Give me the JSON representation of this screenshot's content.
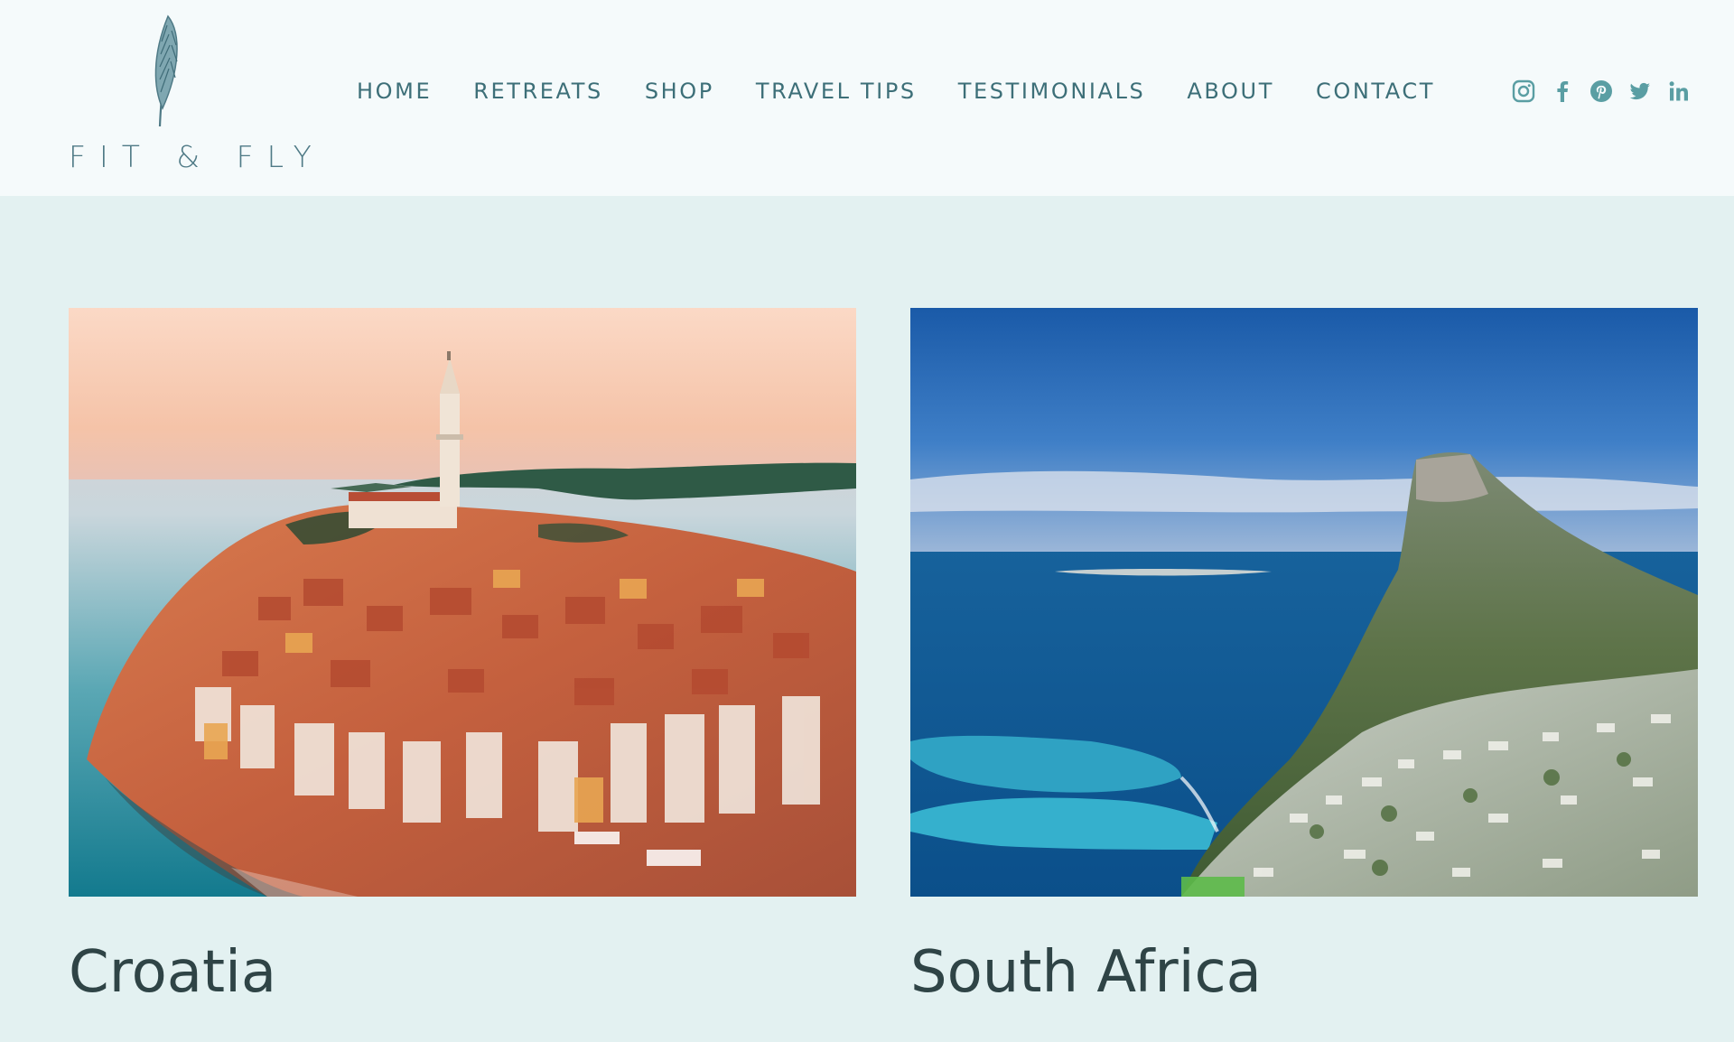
{
  "brand": {
    "name": "FIT & FLY",
    "color": "#4f7a86"
  },
  "nav": {
    "items": [
      {
        "label": "HOME"
      },
      {
        "label": "RETREATS"
      },
      {
        "label": "SHOP"
      },
      {
        "label": "TRAVEL TIPS"
      },
      {
        "label": "TESTIMONIALS"
      },
      {
        "label": "ABOUT"
      },
      {
        "label": "CONTACT"
      }
    ],
    "color": "#3d6f78"
  },
  "social": {
    "icons": [
      "instagram-icon",
      "facebook-icon",
      "pinterest-icon",
      "twitter-icon",
      "linkedin-icon"
    ],
    "color": "#5a9ea3"
  },
  "destinations": [
    {
      "title": "Croatia",
      "image": "aerial-coastal-old-town-with-bell-tower-at-sunset"
    },
    {
      "title": "South Africa",
      "image": "lions-head-mountain-above-coastal-town-and-ocean"
    }
  ],
  "colors": {
    "header_bg": "#f5fafb",
    "page_bg": "#e3f1f1",
    "heading": "#2f4446"
  }
}
